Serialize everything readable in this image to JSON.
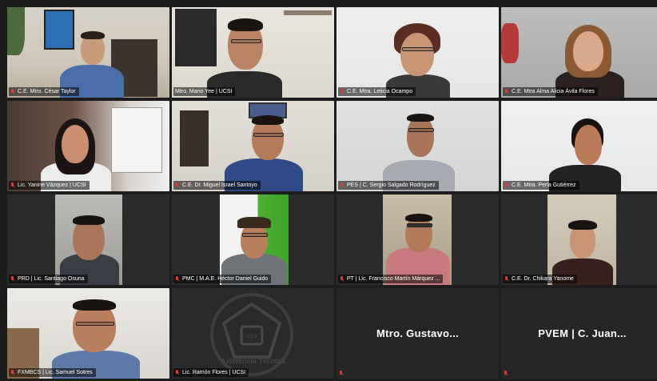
{
  "participants": [
    {
      "label": "C.E. Mtro. César Taylor",
      "muted": true
    },
    {
      "label": "Mtro. Mario Yee | UCSI",
      "muted": false,
      "speaking": true
    },
    {
      "label": "C.E. Mtra. Leticia Ocampo",
      "muted": true
    },
    {
      "label": "C.E. Mtra Alma Alicia Ávila Flores",
      "muted": true
    },
    {
      "label": "Lic. Yanine Vázquez | UCSI",
      "muted": true
    },
    {
      "label": "C.E. Dr. Miguel Israel Santoyo",
      "muted": true
    },
    {
      "label": "PES | C. Sergio Salgado Rodríguez",
      "muted": true
    },
    {
      "label": "C.E. Mtra. Perla Gutiérrez",
      "muted": true
    },
    {
      "label": "PRD | Lic. Santiago Osuna",
      "muted": true
    },
    {
      "label": "PMC | M.A.E. Héctor Daniel Guido",
      "muted": true
    },
    {
      "label": "PT | Lic. Francisco Martín Márquez ...",
      "muted": true
    },
    {
      "label": "C.E. Dr. Chikara Yanome",
      "muted": true
    },
    {
      "label": "FXMBCS | Lic. Samuel Sotres",
      "muted": true
    },
    {
      "label": "Lic. Ramón Flores | UCSI",
      "muted": true
    },
    {
      "label": "",
      "muted": true,
      "display_name": "Mtro.  Gustavo..."
    },
    {
      "label": "",
      "muted": true,
      "display_name": "PVEM | C. Juan..."
    }
  ],
  "avatar_logo_text": "Asistencia Técnica",
  "colors": {
    "active_speaker_border": "#c7d94a",
    "muted_icon": "#e23b3b",
    "tile_bg": "#262626"
  }
}
